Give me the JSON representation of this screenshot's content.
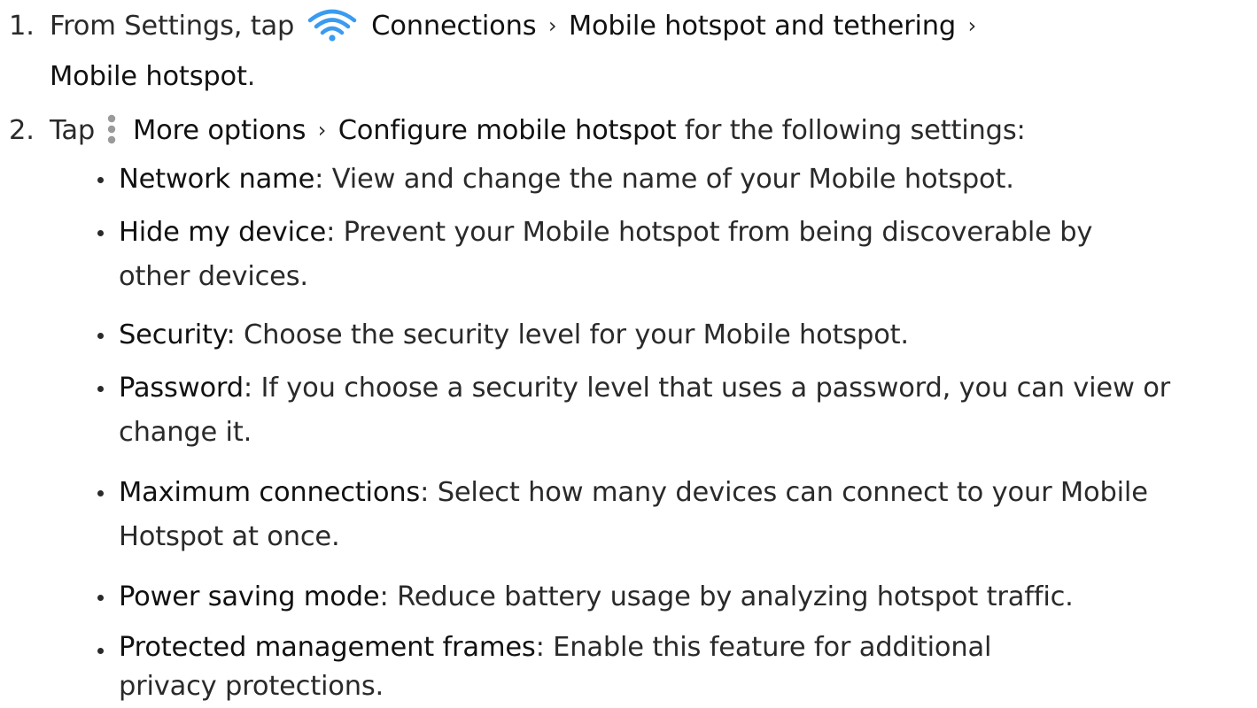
{
  "steps": [
    {
      "number": "1.",
      "prefix": "From Settings, tap",
      "icon": "wifi-icon",
      "path": [
        "Connections",
        "Mobile hotspot and tethering",
        "Mobile hotspot"
      ],
      "separator": "›",
      "suffix": "."
    },
    {
      "number": "2.",
      "prefix": "Tap",
      "icon": "more-options-icon",
      "path": [
        "More options",
        "Configure mobile hotspot"
      ],
      "separator": "›",
      "suffix": "for the following settings:"
    }
  ],
  "settings": [
    {
      "term": "Network name",
      "description": ": View and change the name of your Mobile hotspot."
    },
    {
      "term": "Hide my device",
      "description": ": Prevent your Mobile hotspot from being discoverable by other devices."
    },
    {
      "term": "Security",
      "description": ": Choose the security level for your Mobile hotspot."
    },
    {
      "term": "Password",
      "description": ": If you choose a security level that uses a password, you can view or change it."
    },
    {
      "term": "Maximum connections",
      "description": ": Select how many devices can connect to your Mobile Hotspot at once."
    },
    {
      "term": "Power saving mode",
      "description": ": Reduce battery usage by analyzing hotspot traffic."
    },
    {
      "term": "Protected management frames",
      "description": ": Enable this feature for additional privacy protections."
    }
  ],
  "colors": {
    "wifi_icon": "#3a9bf0",
    "more_options_icon": "#9a9a9a",
    "text": "#2a2a2a"
  }
}
